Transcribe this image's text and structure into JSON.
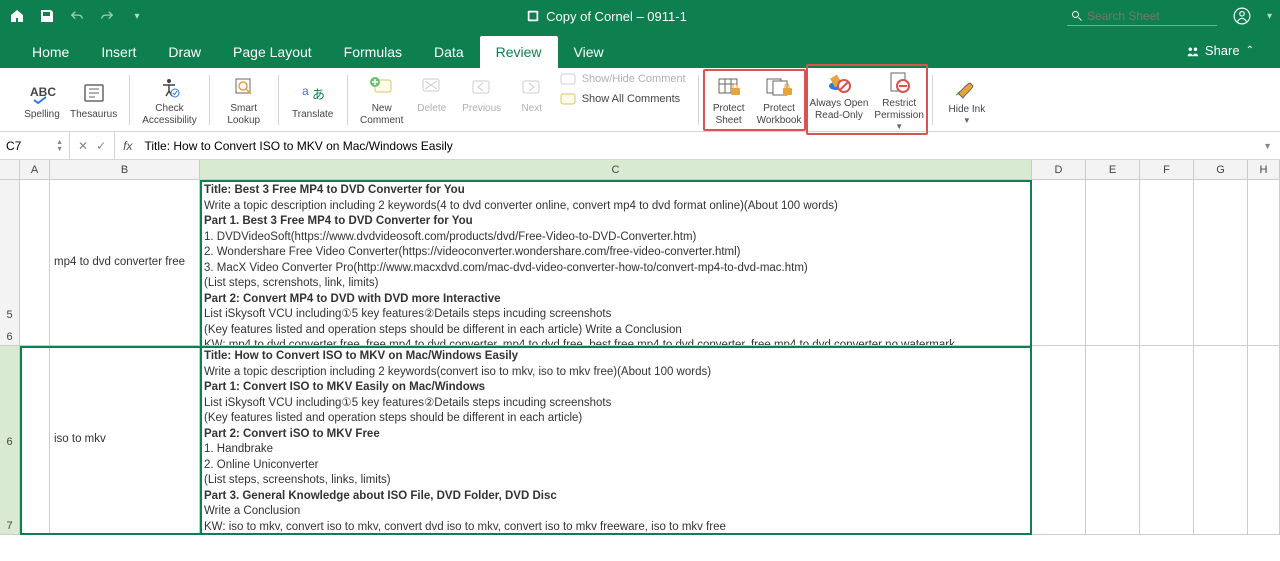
{
  "titlebar": {
    "doc_prefix": "Copy of Cornel – 0911-1",
    "search_placeholder": "Search Sheet"
  },
  "tabs": [
    "Home",
    "Insert",
    "Draw",
    "Page Layout",
    "Formulas",
    "Data",
    "Review",
    "View"
  ],
  "active_tab": "Review",
  "share_label": "Share",
  "ribbon": {
    "spelling": "Spelling",
    "thesaurus": "Thesaurus",
    "check_acc1": "Check",
    "check_acc2": "Accessibility",
    "smart1": "Smart",
    "smart2": "Lookup",
    "translate": "Translate",
    "new_comment1": "New",
    "new_comment2": "Comment",
    "delete": "Delete",
    "previous": "Previous",
    "next": "Next",
    "showhide": "Show/Hide Comment",
    "showall": "Show All Comments",
    "protect_sheet1": "Protect",
    "protect_sheet2": "Sheet",
    "protect_wb1": "Protect",
    "protect_wb2": "Workbook",
    "always1": "Always Open",
    "always2": "Read-Only",
    "restrict1": "Restrict",
    "restrict2": "Permission",
    "hide_ink": "Hide Ink"
  },
  "formula": {
    "cell_ref": "C7",
    "text": "Title: How to Convert ISO to MKV on Mac/Windows Easily"
  },
  "cols": [
    "A",
    "B",
    "C",
    "D",
    "E",
    "F",
    "G",
    "H"
  ],
  "row5": {
    "num": "5",
    "b": "mp4 to dvd converter free",
    "c": "<b>Title: Best 3 Free MP4 to DVD Converter for You</b>\nWrite a topic description including 2 keywords(4 to dvd converter online, convert mp4 to dvd format online)(About 100 words)\n<b>Part 1. Best 3 Free MP4 to DVD Converter for You</b>\n1. DVDVideoSoft(https://www.dvdvideosoft.com/products/dvd/Free-Video-to-DVD-Converter.htm)\n2. Wondershare Free Video Converter(https://videoconverter.wondershare.com/free-video-converter.html)\n3. MacX Video Converter Pro(http://www.macxdvd.com/mac-dvd-video-converter-how-to/convert-mp4-to-dvd-mac.htm)\n(List steps, screnshots, link, limits)\n<b>Part 2: Convert MP4 to DVD with DVD more Interactive</b>\nList iSkysoft VCU including①5 key features②Details steps incuding screenshots"
  },
  "row6": {
    "num": "6",
    "c": "(Key features listed and operation steps should be different in each article) Write a Conclusion\nKW: mp4 to dvd converter free, free mp4 to dvd converter, mp4 to dvd free, best free mp4 to dvd converter, free mp4 to dvd converter no watermark"
  },
  "row7": {
    "num_top": "6",
    "num_bot": "7",
    "b": "iso to mkv",
    "c": "<b>Title: How to Convert ISO to MKV on Mac/Windows Easily</b>\nWrite a topic description including 2 keywords(convert iso to mkv, iso to mkv free)(About 100 words)\n<b>Part 1: Convert ISO to MKV Easily on Mac/Windows</b>\nList iSkysoft VCU including①5 key features②Details steps incuding screenshots\n(Key features listed and operation steps should be different in each article)\n<b>Part 2: Convert iSO to MKV Free</b>\n1. Handbrake\n2. Online Uniconverter\n(List steps, screenshots, links, limits)\n<b>Part 3. General Knowledge about ISO File, DVD Folder, DVD Disc</b>\nWrite a Conclusion\nKW: iso to mkv, convert iso to mkv, convert dvd iso to mkv, convert iso to mkv freeware, iso to mkv free"
  }
}
